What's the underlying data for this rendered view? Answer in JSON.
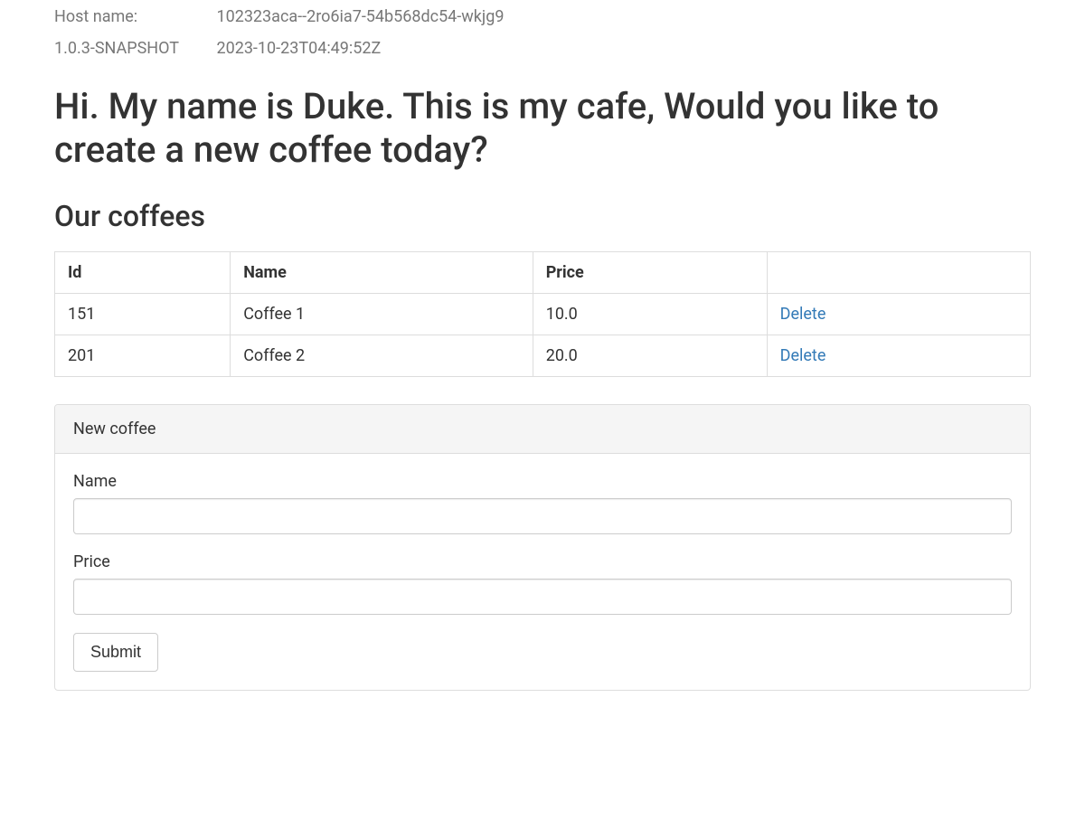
{
  "meta": {
    "hostname_label": "Host name:",
    "hostname_value": "102323aca--2ro6ia7-54b568dc54-wkjg9",
    "version": "1.0.3-SNAPSHOT",
    "build_time": "2023-10-23T04:49:52Z"
  },
  "headings": {
    "main": "Hi. My name is Duke. This is my cafe, Would you like to create a new coffee today?",
    "sub": "Our coffees"
  },
  "table": {
    "headers": {
      "id": "Id",
      "name": "Name",
      "price": "Price",
      "actions": ""
    },
    "rows": [
      {
        "id": "151",
        "name": "Coffee 1",
        "price": "10.0",
        "delete": "Delete"
      },
      {
        "id": "201",
        "name": "Coffee 2",
        "price": "20.0",
        "delete": "Delete"
      }
    ]
  },
  "form": {
    "panel_title": "New coffee",
    "name_label": "Name",
    "name_value": "",
    "price_label": "Price",
    "price_value": "",
    "submit_label": "Submit"
  }
}
